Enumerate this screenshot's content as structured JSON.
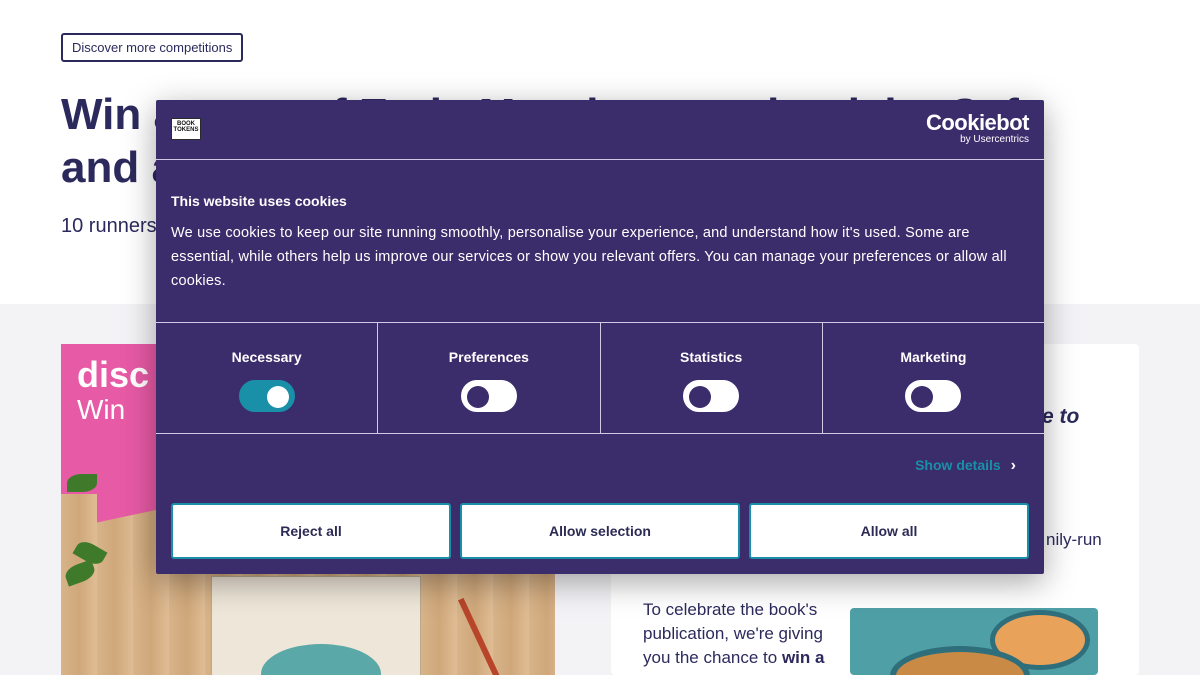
{
  "page": {
    "discover_button": "Discover more competitions",
    "title": "Win a copy of Early Morning, one book by Cafe and a",
    "subtitle": "10 runners",
    "promo": {
      "disc_text": "disc",
      "win_text": "Win"
    },
    "info": {
      "italic_text": "e to",
      "family_text": "nily-run",
      "body_prefix": "To celebrate the book's publication, we're giving you the chance to",
      "body_bold": "win a"
    }
  },
  "cookie": {
    "logo_text": "BOOK TOKENS",
    "brand_name": "Cookiebot",
    "brand_sub": "by Usercentrics",
    "title": "This website uses cookies",
    "body": "We use cookies to keep our site running smoothly, personalise your experience, and understand how it's used. Some are essential, while others help us improve our services or show you relevant offers. You can manage your preferences or allow all cookies.",
    "categories": [
      {
        "label": "Necessary",
        "checked": true
      },
      {
        "label": "Preferences",
        "checked": false
      },
      {
        "label": "Statistics",
        "checked": false
      },
      {
        "label": "Marketing",
        "checked": false
      }
    ],
    "show_details": "Show details",
    "buttons": {
      "reject": "Reject all",
      "selection": "Allow selection",
      "allow": "Allow all"
    },
    "colors": {
      "dialog_bg": "#3b2c6b",
      "accent": "#1a8fa8"
    }
  }
}
